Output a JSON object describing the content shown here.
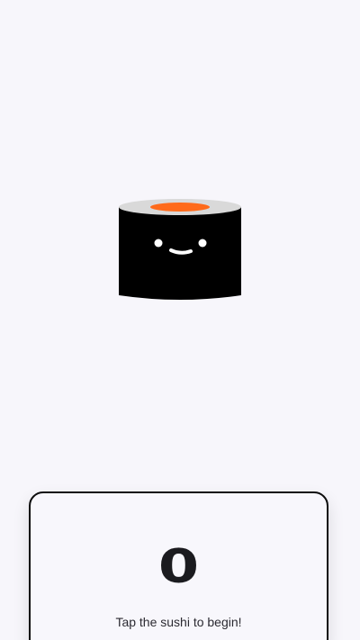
{
  "sushi": {
    "icon": "sushi-roll-icon",
    "colors": {
      "seaweed": "#000000",
      "rice": "#d9d9d9",
      "salmon": "#ff6a1a",
      "face": "#ffffff"
    }
  },
  "counter": {
    "value": "0",
    "hint": "Tap the sushi to begin!"
  }
}
